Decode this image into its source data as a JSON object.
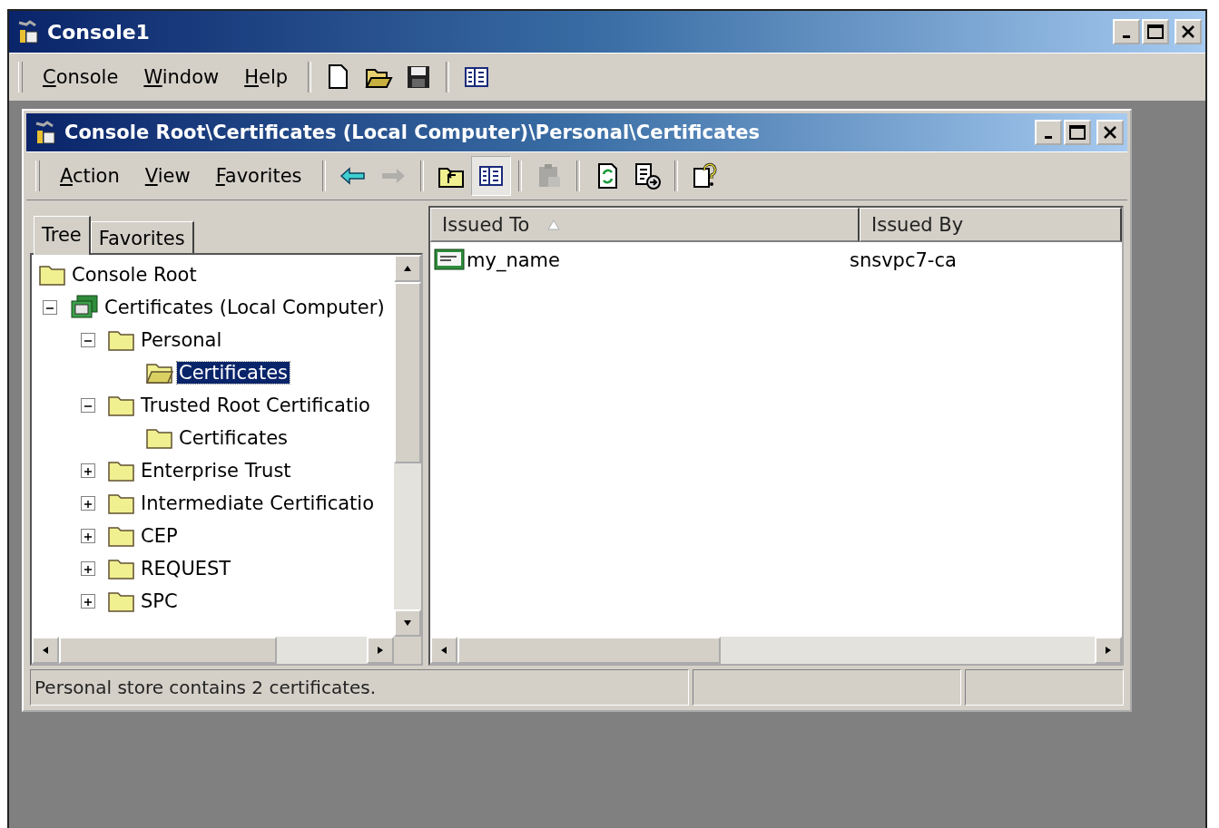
{
  "window": {
    "title": "Console1"
  },
  "menu": [
    "Console",
    "Window",
    "Help"
  ],
  "toolbar": [
    {
      "kind": "new",
      "disabled": false
    },
    {
      "kind": "open",
      "disabled": false
    },
    {
      "kind": "save",
      "disabled": false
    },
    {
      "kind": "separator"
    },
    {
      "kind": "tree-toggle",
      "disabled": false
    }
  ],
  "child_window": {
    "title": "Console Root\\Certificates (Local Computer)\\Personal\\Certificates",
    "menu": [
      "Action",
      "View",
      "Favorites"
    ],
    "toolbar": [
      {
        "kind": "back",
        "disabled": false
      },
      {
        "kind": "forward",
        "disabled": true
      },
      {
        "kind": "separator"
      },
      {
        "kind": "up",
        "disabled": false
      },
      {
        "kind": "tree-toggle",
        "disabled": false,
        "pressed": true
      },
      {
        "kind": "separator"
      },
      {
        "kind": "delete",
        "disabled": true
      },
      {
        "kind": "separator"
      },
      {
        "kind": "refresh",
        "disabled": false
      },
      {
        "kind": "export",
        "disabled": false
      },
      {
        "kind": "separator"
      },
      {
        "kind": "help",
        "disabled": false
      }
    ],
    "tabs": [
      {
        "label": "Tree",
        "selected": true
      },
      {
        "label": "Favorites",
        "selected": false
      }
    ],
    "tree": [
      {
        "label": "Console Root",
        "kind": "folder",
        "selected": false,
        "children": [
          {
            "label": "Certificates (Local Computer)",
            "kind": "store",
            "selected": false,
            "expanded": true,
            "children": [
              {
                "label": "Personal",
                "kind": "folder",
                "selected": false,
                "expanded": true,
                "children": [
                  {
                    "label": "Certificates",
                    "kind": "open-folder",
                    "selected": true
                  }
                ]
              },
              {
                "label": "Trusted Root Certificatio",
                "kind": "folder",
                "selected": false,
                "expanded": true,
                "children": [
                  {
                    "label": "Certificates",
                    "kind": "folder",
                    "selected": false
                  }
                ]
              },
              {
                "label": "Enterprise Trust",
                "kind": "folder",
                "selected": false,
                "expanded": false
              },
              {
                "label": "Intermediate Certificatio",
                "kind": "folder",
                "selected": false,
                "expanded": false
              },
              {
                "label": "CEP",
                "kind": "folder",
                "selected": false,
                "expanded": false
              },
              {
                "label": "REQUEST",
                "kind": "folder",
                "selected": false,
                "expanded": false
              },
              {
                "label": "SPC",
                "kind": "folder",
                "selected": false,
                "expanded": false
              }
            ]
          }
        ]
      }
    ],
    "list": {
      "columns": [
        {
          "label": "Issued To",
          "sorted": true
        },
        {
          "label": "Issued By",
          "sorted": false
        }
      ],
      "rows": [
        {
          "issued_to": "my_name",
          "issued_by": "snsvpc7-ca"
        }
      ]
    },
    "status_bar": [
      "Personal store contains 2 certificates."
    ]
  }
}
